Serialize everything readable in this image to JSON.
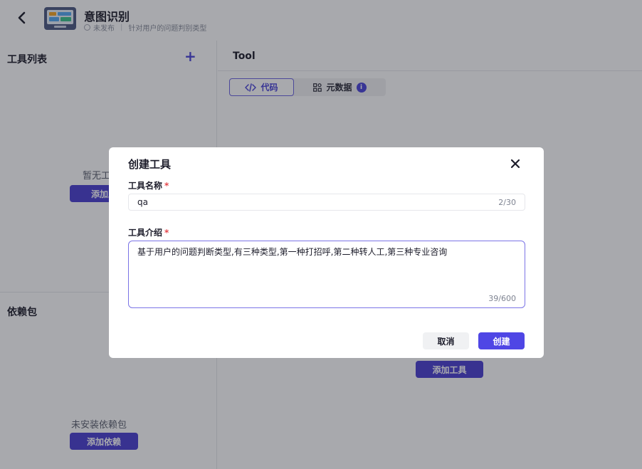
{
  "header": {
    "title": "意图识别",
    "status": "未发布",
    "description": "针对用户的问题判别类型"
  },
  "left_panel": {
    "tools_title": "工具列表",
    "tools_empty": "暂无工",
    "add_tool_label": "添加工",
    "deps_title": "依赖包",
    "deps_empty": "未安装依赖包",
    "add_dep_label": "添加依赖"
  },
  "right_panel": {
    "title": "Tool",
    "tab_code": "代码",
    "tab_meta": "元数据",
    "add_tool_label": "添加工具"
  },
  "modal": {
    "title": "创建工具",
    "name_label": "工具名称",
    "name_value": "qa",
    "name_count": "2/30",
    "desc_label": "工具介绍",
    "desc_value": "基于用户的问题判断类型,有三种类型,第一种打招呼,第二种转人工,第三种专业咨询",
    "desc_count": "39/600",
    "cancel_label": "取消",
    "create_label": "创建"
  },
  "colors": {
    "accent": "#4f46e5",
    "accent_dark": "#4b3fd0",
    "required": "#e5484d"
  },
  "icons": {
    "back": "chevron-left-icon",
    "app": "app-monitor-icon",
    "add": "plus-icon",
    "code": "code-icon",
    "meta": "grid-icon",
    "info": "info-icon",
    "close": "close-icon"
  }
}
